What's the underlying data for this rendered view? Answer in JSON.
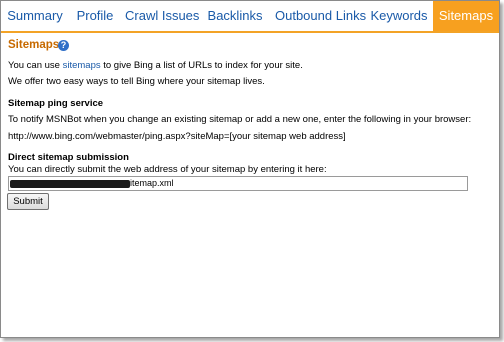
{
  "tabs": [
    {
      "label": "Summary"
    },
    {
      "label": "Profile"
    },
    {
      "label": "Crawl Issues"
    },
    {
      "label": "Backlinks"
    },
    {
      "label": "Outbound Links"
    },
    {
      "label": "Keywords"
    },
    {
      "label": "Sitemaps",
      "active": true
    }
  ],
  "colors": {
    "accent": "#f7a01f",
    "link": "#1a5aa8",
    "heading": "#c76a00"
  },
  "sitemaps": {
    "title": "Sitemaps",
    "help_icon": "question-circle-icon",
    "intro_before": "You can use ",
    "intro_link": "sitemaps",
    "intro_after": " to give Bing a list of URLs to index for your site.",
    "intro2": "We offer two easy ways to tell Bing where your sitemap lives."
  },
  "ping": {
    "title": "Sitemap ping service",
    "desc": "To notify MSNBot when you change an existing sitemap or add a new one, enter the following in your browser:",
    "url": "http://www.bing.com/webmaster/ping.aspx?siteMap=[your sitemap web address]"
  },
  "direct": {
    "title": "Direct sitemap submission",
    "desc": "You can directly submit the web address of your sitemap by entering it here:",
    "input_value_visible": "itemap.xml",
    "submit_label": "Submit"
  }
}
